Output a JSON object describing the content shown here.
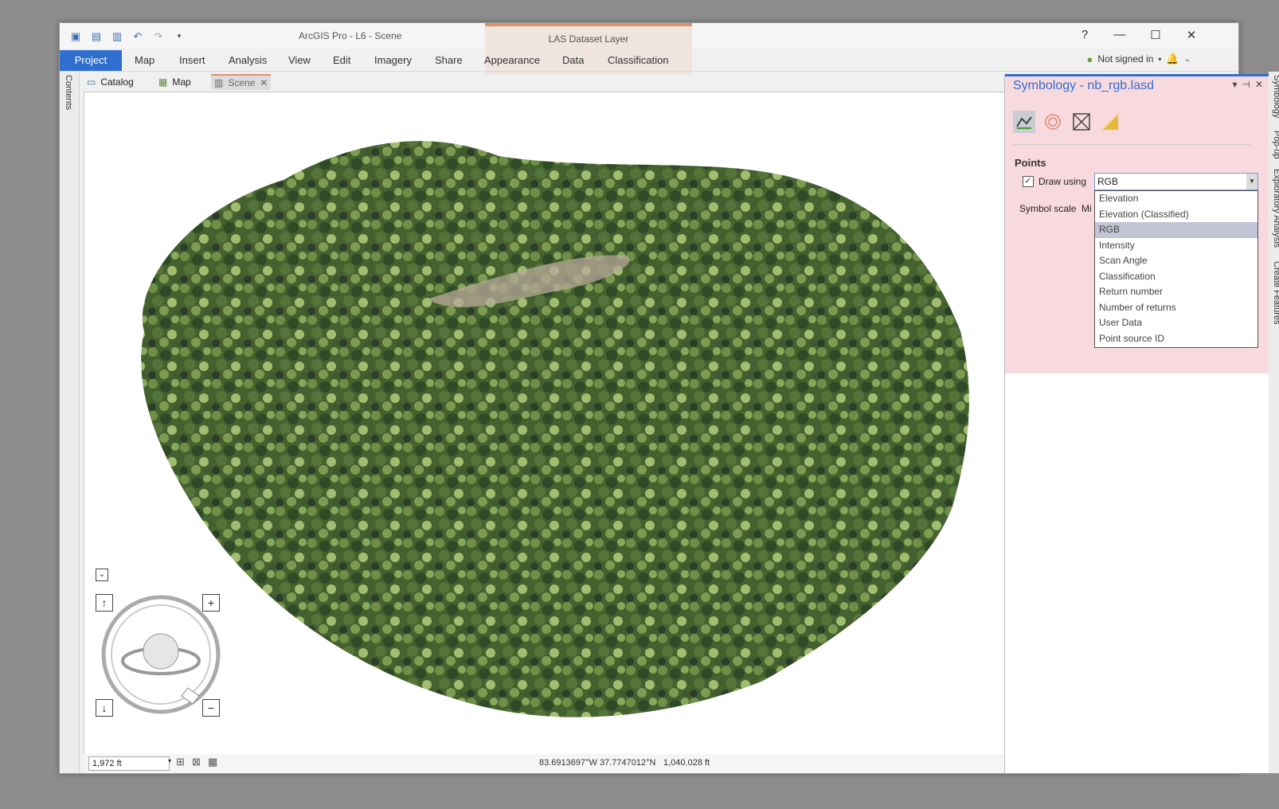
{
  "window": {
    "title": "ArcGIS Pro - L6 - Scene",
    "contextual_group": "LAS Dataset Layer",
    "help_label": "?",
    "minimize_label": "—",
    "maximize_label": "☐",
    "close_label": "✕"
  },
  "ribbon": {
    "tabs": [
      "Project",
      "Map",
      "Insert",
      "Analysis",
      "View",
      "Edit",
      "Imagery",
      "Share",
      "Appearance",
      "Data",
      "Classification"
    ]
  },
  "signin": {
    "label": "Not signed in"
  },
  "left_strip": {
    "contents_label": "Contents"
  },
  "doc_tabs": [
    {
      "label": "Catalog"
    },
    {
      "label": "Map"
    },
    {
      "label": "Scene"
    }
  ],
  "status": {
    "scale": "1,972 ft",
    "coordinates": "83.6913697°W 37.7747012°N",
    "elevation": "1,040.028 ft"
  },
  "symbology": {
    "title": "Symbology - nb_rgb.lasd",
    "section": "Points",
    "draw_using_label": "Draw using",
    "draw_using_value": "RGB",
    "symbol_scale_label": "Symbol scale",
    "symbol_scale_value": "Mi",
    "options": [
      "Elevation",
      "Elevation (Classified)",
      "RGB",
      "Intensity",
      "Scan Angle",
      "Classification",
      "Return number",
      "Number of returns",
      "User Data",
      "Point source ID"
    ],
    "selected_option": "RGB"
  },
  "right_strip": {
    "tabs": [
      "Symbology",
      "Pop-up",
      "Exploratory Analysis",
      "Create Features"
    ]
  },
  "colors": {
    "accent": "#2f6fcf",
    "contextual": "#e0916a",
    "highlight": "#f8d9de",
    "canopy_dark": "#3d5a2c",
    "canopy_light": "#8fb063"
  }
}
